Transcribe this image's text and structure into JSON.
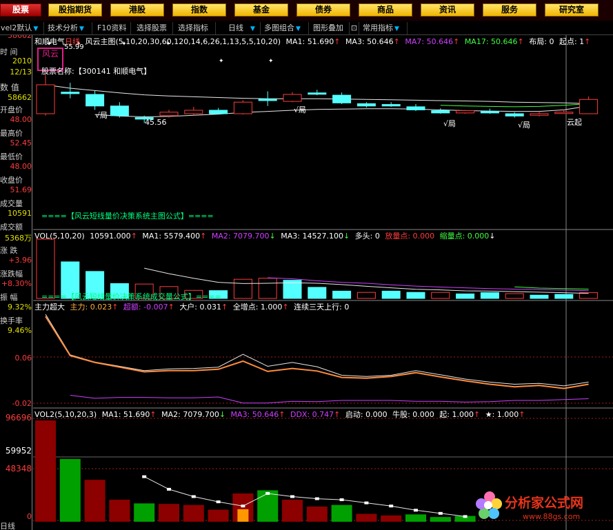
{
  "nav": [
    "股票",
    "股指期货",
    "港股",
    "指数",
    "基金",
    "债券",
    "商品",
    "资讯",
    "服务",
    "研究室"
  ],
  "toolbar": {
    "template": "vel2默认",
    "items": [
      "技术分析",
      "F10资料",
      "选择股票",
      "选择指标",
      "日线",
      "多图组合",
      "图形叠加",
      "常用指标"
    ]
  },
  "left": {
    "labels": [
      "时  间",
      "数  值",
      "开盘价",
      "最高价",
      "最低价",
      "收盘价",
      "成交量",
      "成交额",
      "涨  跌",
      "涨跌幅",
      "振  幅",
      "换手率"
    ],
    "date": [
      "2010",
      "12/13"
    ],
    "value": "58662",
    "open": "48.00",
    "high": "52.45",
    "low": "48.00",
    "close": "51.69",
    "volume": "10591",
    "amount": "5368万",
    "change": "+3.96",
    "change_pct": "+8.30%",
    "amplitude": "9.32%",
    "turnover": "9.46%",
    "scale_main": "58662",
    "scale_ind": [
      "0.06",
      "-0.02"
    ],
    "scale_vol2": [
      "96696",
      "59952",
      "48348",
      "0"
    ],
    "bottom": "日线"
  },
  "main_title": {
    "stock": "和顺电气",
    "period": "日线",
    "indicator": "风云主图",
    "params": "(5,10,20,30,60,120,14,6,26,1,13,5,5,10,20)",
    "ma1": "MA1: 51.690",
    "ma3": "MA3: 50.646",
    "ma7": "MA7: 50.646",
    "ma17": "MA17: 50.646",
    "buju": "布局: 0",
    "qidian": "起点: 1"
  },
  "stock_name_label": "股票名称:【300141 和顺电气】",
  "logo_text": "风云",
  "price_label": "55.99",
  "low_label": "45.56",
  "ju_label": "√局",
  "yunqi_label": "云起",
  "formula_main": "====【风云短线量价决策系统主图公式】====",
  "formula_vol": "====【风云短线量价决策系统成交量公式】====",
  "vol_title": {
    "name": "VOL(5,10,20)",
    "v": "10591.000",
    "ma1": "MA1: 5579.400",
    "ma2": "MA2: 7079.700",
    "ma3": "MA3: 14527.100",
    "duotou": "多头: 0",
    "fangliang": "放量点: 0.000",
    "suoliang": "缩量点: 0.000"
  },
  "ind_title": {
    "name": "主力超大",
    "zhuli": "主力: 0.023",
    "chao": "超额: -0.007",
    "dahu": "大户: 0.031",
    "quanzeng": "全增点: 1.000",
    "lianxu": "连续三天上行: 0"
  },
  "vol2_title": {
    "name": "VOL2(5,10,20,3)",
    "ma1": "MA1: 51.690",
    "ma2": "MA2: 7079.700",
    "ma3": "MA3: 50.646",
    "ddx": "DDX: 0.747",
    "qidong": "启动: 0.000",
    "niugu": "牛股: 0.000",
    "qi": "起: 1.000",
    "star": "★: 1.000"
  },
  "watermark": {
    "text": "分析家公式网",
    "url": "www.88gs.com"
  },
  "colors": {
    "up": "#ff3c3c",
    "down": "#54ffff",
    "white_line": "#e8e8e8",
    "orange_line": "#ff8c3c",
    "purple_line": "#d040ff",
    "green_line": "#40ff40",
    "dark_red": "#8c0000",
    "green_bar": "#00a000"
  },
  "chart_data": {
    "candles": [
      {
        "o": 48.0,
        "c": 55.5,
        "h": 58.0,
        "l": 47.5,
        "up": true
      },
      {
        "o": 53.2,
        "c": 53.6,
        "h": 56.0,
        "l": 52.0,
        "up": false
      },
      {
        "o": 53.0,
        "c": 50.0,
        "h": 54.0,
        "l": 49.0,
        "up": false
      },
      {
        "o": 50.0,
        "c": 47.5,
        "h": 51.0,
        "l": 47.0,
        "up": false
      },
      {
        "o": 47.0,
        "c": 46.6,
        "h": 47.5,
        "l": 45.6,
        "up": false
      },
      {
        "o": 47.5,
        "c": 48.4,
        "h": 49.0,
        "l": 47.0,
        "up": true
      },
      {
        "o": 48.0,
        "c": 48.9,
        "h": 49.8,
        "l": 47.6,
        "up": true
      },
      {
        "o": 48.9,
        "c": 48.0,
        "h": 49.5,
        "l": 47.9,
        "up": false
      },
      {
        "o": 48.0,
        "c": 51.0,
        "h": 51.5,
        "l": 47.8,
        "up": true
      },
      {
        "o": 51.4,
        "c": 51.8,
        "h": 53.8,
        "l": 50.0,
        "up": false
      },
      {
        "o": 51.2,
        "c": 53.0,
        "h": 53.6,
        "l": 51.0,
        "up": true
      },
      {
        "o": 53.2,
        "c": 53.4,
        "h": 54.2,
        "l": 52.8,
        "up": false
      },
      {
        "o": 52.8,
        "c": 50.8,
        "h": 53.5,
        "l": 50.5,
        "up": false
      },
      {
        "o": 50.6,
        "c": 50.0,
        "h": 51.0,
        "l": 49.6,
        "up": false
      },
      {
        "o": 50.4,
        "c": 50.0,
        "h": 51.0,
        "l": 49.8,
        "up": false
      },
      {
        "o": 49.8,
        "c": 49.0,
        "h": 50.5,
        "l": 48.7,
        "up": false
      },
      {
        "o": 48.8,
        "c": 48.2,
        "h": 49.4,
        "l": 48.0,
        "up": false
      },
      {
        "o": 48.2,
        "c": 48.8,
        "h": 49.0,
        "l": 48.0,
        "up": true
      },
      {
        "o": 48.6,
        "c": 48.2,
        "h": 49.3,
        "l": 48.0,
        "up": false
      },
      {
        "o": 48.0,
        "c": 47.4,
        "h": 48.4,
        "l": 47.0,
        "up": false
      },
      {
        "o": 47.6,
        "c": 48.0,
        "h": 48.4,
        "l": 47.3,
        "up": true
      },
      {
        "o": 48.2,
        "c": 48.4,
        "h": 49.0,
        "l": 48.0,
        "up": true
      },
      {
        "o": 48.0,
        "c": 51.7,
        "h": 52.45,
        "l": 48.0,
        "up": true
      }
    ],
    "ma_main": [
      55.5,
      54.6,
      54.0,
      53.4,
      52.9,
      52.6,
      52.4,
      52.2,
      52.0,
      51.9,
      51.9,
      51.9,
      51.8,
      51.7,
      51.6,
      51.5,
      51.4,
      51.3,
      51.2,
      51.0,
      50.9,
      50.8,
      50.6
    ],
    "ma_main2": [
      null,
      null,
      47.8,
      47.4,
      47.2,
      47.3,
      47.6,
      47.9,
      48.3,
      48.6,
      48.9,
      49.1,
      49.2,
      49.3,
      49.3,
      49.2,
      49.0,
      48.8,
      48.7,
      48.6,
      48.6,
      49.0,
      50.0
    ],
    "ma_main3": [
      null,
      null,
      null,
      null,
      null,
      null,
      null,
      null,
      null,
      null,
      null,
      null,
      null,
      null,
      null,
      null,
      50.2,
      50.0,
      49.9,
      49.8,
      49.9,
      50.2,
      50.6
    ],
    "vol": [
      {
        "v": 23500,
        "up": true
      },
      {
        "v": 14500,
        "up": false
      },
      {
        "v": 10700,
        "up": false
      },
      {
        "v": 5900,
        "up": false
      },
      {
        "v": 5700,
        "up": true
      },
      {
        "v": 4700,
        "up": true
      },
      {
        "v": 3200,
        "up": true
      },
      {
        "v": 3100,
        "up": false
      },
      {
        "v": 7600,
        "up": true
      },
      {
        "v": 8000,
        "up": true
      },
      {
        "v": 7200,
        "up": false
      },
      {
        "v": 4400,
        "up": false
      },
      {
        "v": 2900,
        "up": false
      },
      {
        "v": 2400,
        "up": true
      },
      {
        "v": 2900,
        "up": false
      },
      {
        "v": 2400,
        "up": false
      },
      {
        "v": 2400,
        "up": true
      },
      {
        "v": 1800,
        "up": false
      },
      {
        "v": 2300,
        "up": false
      },
      {
        "v": 1900,
        "up": true
      },
      {
        "v": 1300,
        "up": false
      },
      {
        "v": 1600,
        "up": false
      },
      {
        "v": 2300,
        "up": true
      }
    ],
    "vol_ma1": [
      null,
      null,
      null,
      null,
      12000,
      9800,
      8000,
      6400,
      5900,
      6000,
      6200,
      6000,
      5500,
      4800,
      4200,
      3600,
      3400,
      3000,
      2900,
      2700,
      2500,
      2300,
      2000
    ],
    "vol_ma2": [
      null,
      null,
      null,
      null,
      null,
      null,
      null,
      null,
      null,
      8200,
      7800,
      7000,
      6400,
      6000,
      5400,
      4900,
      4500,
      4200,
      3900,
      3700,
      3500,
      3300,
      3100
    ],
    "vol_ma3": [
      null,
      null,
      null,
      null,
      null,
      null,
      null,
      null,
      null,
      null,
      null,
      null,
      null,
      null,
      null,
      null,
      null,
      null,
      null,
      4600,
      4100,
      3900,
      3700
    ],
    "ind_white": [
      0.19,
      0.095,
      0.078,
      0.068,
      0.058,
      0.062,
      0.063,
      0.066,
      0.096,
      0.068,
      0.077,
      0.067,
      0.047,
      0.044,
      0.047,
      0.058,
      0.048,
      0.038,
      0.031,
      0.026,
      0.028,
      0.022,
      0.031
    ],
    "ind_orange": [
      0.185,
      0.093,
      0.077,
      0.066,
      0.055,
      0.058,
      0.058,
      0.061,
      0.08,
      0.056,
      0.063,
      0.057,
      0.042,
      0.04,
      0.044,
      0.053,
      0.043,
      0.034,
      0.026,
      0.02,
      0.023,
      0.016,
      0.026
    ],
    "ind_purple": [
      null,
      0.0,
      -0.007,
      -0.005,
      -0.005,
      -0.006,
      -0.006,
      -0.004,
      -0.018,
      -0.018,
      -0.014,
      -0.015,
      -0.012,
      -0.012,
      -0.012,
      -0.014,
      -0.014,
      -0.016,
      -0.015,
      -0.012,
      -0.012,
      -0.01,
      -0.008
    ],
    "vol2": [
      {
        "v": 96696,
        "c": "r"
      },
      {
        "v": 59952,
        "c": "g"
      },
      {
        "v": 40000,
        "c": "r"
      },
      {
        "v": 21000,
        "c": "r"
      },
      {
        "v": 17500,
        "c": "g"
      },
      {
        "v": 17000,
        "c": "r"
      },
      {
        "v": 16000,
        "c": "r"
      },
      {
        "v": 11500,
        "c": "r"
      },
      {
        "v": 27000,
        "c": "r"
      },
      {
        "v": 30000,
        "c": "g"
      },
      {
        "v": 21000,
        "c": "r"
      },
      {
        "v": 14500,
        "c": "r"
      },
      {
        "v": 16000,
        "c": "g"
      },
      {
        "v": 7500,
        "c": "r"
      },
      {
        "v": 6000,
        "c": "r"
      },
      {
        "v": 7000,
        "c": "g"
      },
      {
        "v": 4500,
        "c": "g"
      },
      {
        "v": 5500,
        "c": "g"
      }
    ],
    "vol2_inner": [
      null,
      null,
      null,
      null,
      null,
      null,
      null,
      null,
      12000,
      null,
      null,
      null,
      null,
      null,
      null,
      null,
      null,
      null
    ],
    "vol2_line": [
      null,
      null,
      null,
      null,
      43000,
      31000,
      24000,
      19000,
      15000,
      27000,
      24000,
      22000,
      21000,
      18000,
      15000,
      11000,
      8000,
      5000
    ],
    "vol2_range": [
      0,
      100000
    ]
  }
}
